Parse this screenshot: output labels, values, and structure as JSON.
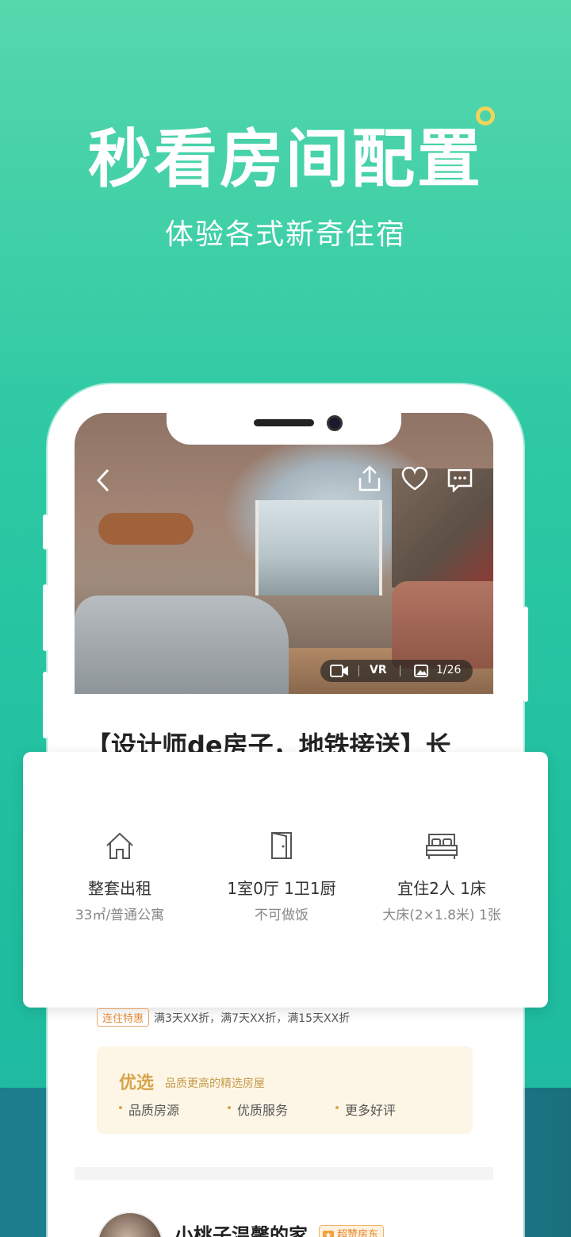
{
  "hero": {
    "title": "秒看房间配置",
    "subtitle": "体验各式新奇住宿"
  },
  "photo_overlay": {
    "video_label": "",
    "vr_label": "VR",
    "counter": "1/26"
  },
  "listing": {
    "title": "【设计师de房子，地铁接送】长"
  },
  "features": [
    {
      "icon": "house-icon",
      "main": "整套出租",
      "sub": "33㎡/普通公寓"
    },
    {
      "icon": "door-icon",
      "main": "1室0厅 1卫1厨",
      "sub": "不可做饭"
    },
    {
      "icon": "bed-icon",
      "main": "宜住2人 1床",
      "sub": "大床(2×1.8米) 1张"
    }
  ],
  "promo": {
    "tag": "连住特惠",
    "text": "满3天XX折，满7天XX折，满15天XX折"
  },
  "premium": {
    "title": "优选",
    "desc": "品质更高的精选房屋",
    "points": [
      "品质房源",
      "优质服务",
      "更多好评"
    ]
  },
  "host": {
    "name": "小桃子温馨的家",
    "badge": "超赞房东"
  },
  "colors": {
    "brand_green": "#2ec9a4",
    "accent_gold": "#d7a54c",
    "promo_orange": "#e58a3a"
  }
}
